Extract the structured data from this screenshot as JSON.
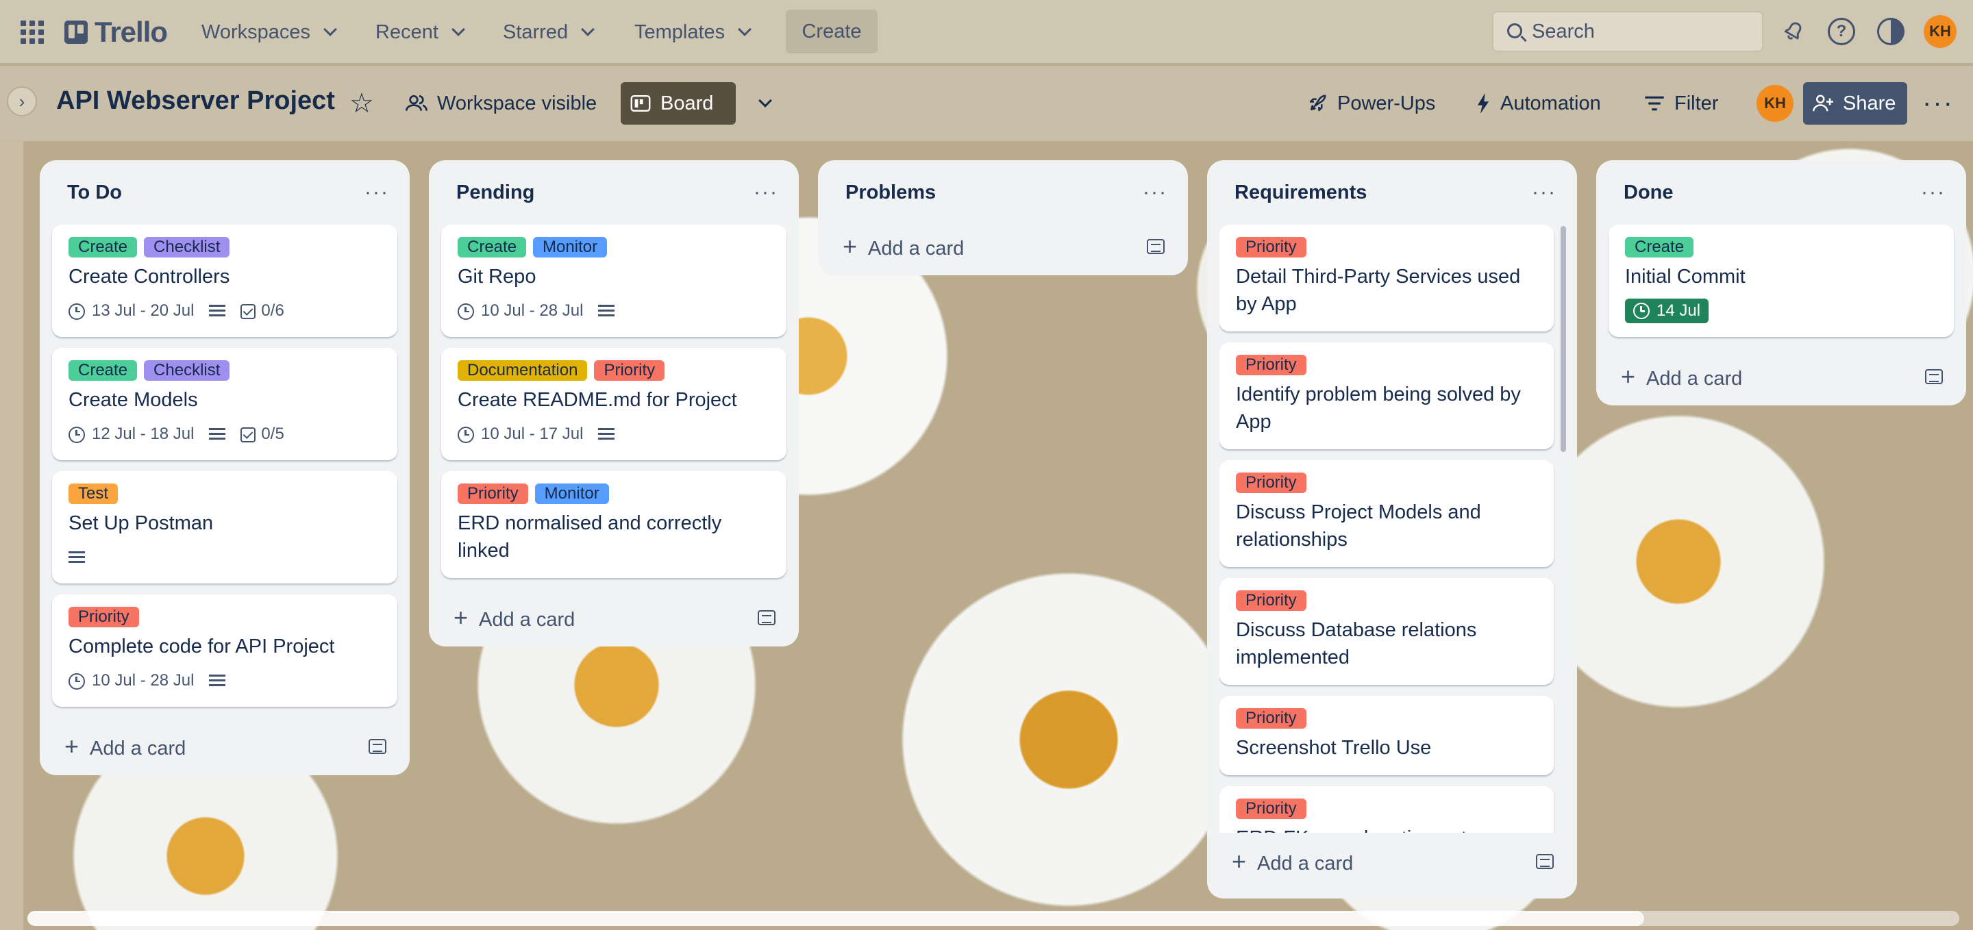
{
  "topnav": {
    "logo": "Trello",
    "items": [
      "Workspaces",
      "Recent",
      "Starred",
      "Templates"
    ],
    "create_label": "Create",
    "search_placeholder": "Search",
    "avatar_initials": "KH"
  },
  "board": {
    "title": "API Webserver Project",
    "visibility_label": "Workspace visible",
    "view_label": "Board",
    "powerups_label": "Power-Ups",
    "automation_label": "Automation",
    "filter_label": "Filter",
    "member_initials": "KH",
    "share_label": "Share"
  },
  "add_card_label": "Add a card",
  "lists": [
    {
      "title": "To Do",
      "cards": [
        {
          "labels": [
            "Create",
            "Checklist"
          ],
          "title": "Create Controllers",
          "dates": "13 Jul - 20 Jul",
          "checklist": "0/6"
        },
        {
          "labels": [
            "Create",
            "Checklist"
          ],
          "title": "Create Models",
          "dates": "12 Jul - 18 Jul",
          "checklist": "0/5"
        },
        {
          "labels": [
            "Test"
          ],
          "title": "Set Up Postman"
        },
        {
          "labels": [
            "Priority"
          ],
          "title": "Complete code for API Project",
          "dates": "10 Jul - 28 Jul"
        }
      ]
    },
    {
      "title": "Pending",
      "cards": [
        {
          "labels": [
            "Create",
            "Monitor"
          ],
          "title": "Git Repo",
          "dates": "10 Jul - 28 Jul"
        },
        {
          "labels": [
            "Documentation",
            "Priority"
          ],
          "title": "Create README.md for Project",
          "dates": "10 Jul - 17 Jul"
        },
        {
          "labels": [
            "Priority",
            "Monitor"
          ],
          "title": "ERD normalised and correctly linked"
        }
      ]
    },
    {
      "title": "Problems",
      "cards": []
    },
    {
      "title": "Requirements",
      "cards": [
        {
          "labels": [
            "Priority"
          ],
          "title": "Detail Third-Party Services used by App"
        },
        {
          "labels": [
            "Priority"
          ],
          "title": "Identify problem being solved by App"
        },
        {
          "labels": [
            "Priority"
          ],
          "title": "Discuss Project Models and relationships"
        },
        {
          "labels": [
            "Priority"
          ],
          "title": "Discuss Database relations implemented"
        },
        {
          "labels": [
            "Priority"
          ],
          "title": "Screenshot Trello Use"
        },
        {
          "labels": [
            "Priority"
          ],
          "title": "ERD FKs need sorting out"
        }
      ]
    },
    {
      "title": "Done",
      "cards": [
        {
          "labels": [
            "Create"
          ],
          "title": "Initial Commit",
          "due": "14 Jul"
        }
      ]
    }
  ]
}
